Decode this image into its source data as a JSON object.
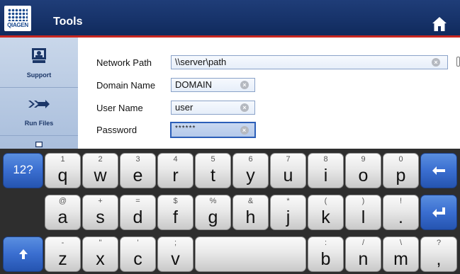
{
  "header": {
    "logo_text": "QIAGEN",
    "title": "Tools",
    "home_icon": "home-icon"
  },
  "sidebar": {
    "items": [
      {
        "label": "Support",
        "icon": "support-icon"
      },
      {
        "label": "Run Files",
        "icon": "run-files-icon"
      }
    ]
  },
  "form": {
    "network_path": {
      "label": "Network Path",
      "value": "\\\\server\\path"
    },
    "domain_name": {
      "label": "Domain Name",
      "value": "DOMAIN"
    },
    "user_name": {
      "label": "User Name",
      "value": "user"
    },
    "password": {
      "label": "Password",
      "value": "******"
    }
  },
  "keyboard": {
    "row1": [
      {
        "sec": "1",
        "pri": "q"
      },
      {
        "sec": "2",
        "pri": "w"
      },
      {
        "sec": "3",
        "pri": "e"
      },
      {
        "sec": "4",
        "pri": "r"
      },
      {
        "sec": "5",
        "pri": "t"
      },
      {
        "sec": "6",
        "pri": "y"
      },
      {
        "sec": "7",
        "pri": "u"
      },
      {
        "sec": "8",
        "pri": "i"
      },
      {
        "sec": "9",
        "pri": "o"
      },
      {
        "sec": "0",
        "pri": "p"
      }
    ],
    "row2": [
      {
        "sec": "@",
        "pri": "a"
      },
      {
        "sec": "+",
        "pri": "s"
      },
      {
        "sec": "=",
        "pri": "d"
      },
      {
        "sec": "$",
        "pri": "f"
      },
      {
        "sec": "%",
        "pri": "g"
      },
      {
        "sec": "&",
        "pri": "h"
      },
      {
        "sec": "*",
        "pri": "j"
      },
      {
        "sec": "(",
        "pri": "k"
      },
      {
        "sec": ")",
        "pri": "l"
      },
      {
        "sec": "!",
        "pri": "."
      }
    ],
    "row3": [
      {
        "sec": "-",
        "pri": "z"
      },
      {
        "sec": "\"",
        "pri": "x"
      },
      {
        "sec": "'",
        "pri": "c"
      },
      {
        "sec": ";",
        "pri": "v"
      },
      {
        "sec": ":",
        "pri": "b"
      },
      {
        "sec": "/",
        "pri": "n"
      },
      {
        "sec": "\\",
        "pri": "m"
      },
      {
        "sec": "?",
        "pri": ","
      }
    ],
    "mode_key": "12?",
    "colors": {
      "accent": "#3a6ed0",
      "header": "#17336a",
      "header_line": "#c82620"
    }
  }
}
